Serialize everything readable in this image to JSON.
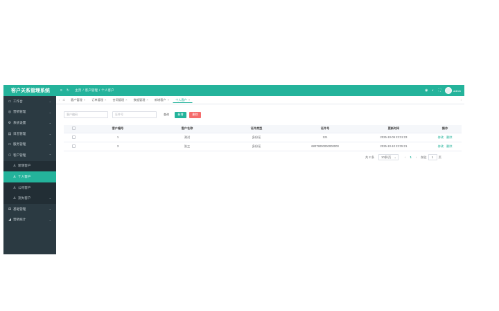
{
  "app": {
    "title": "客户关系管理系统"
  },
  "sidebar": {
    "items": [
      {
        "label": "工作台",
        "icon": "monitor-icon",
        "glyph": "▭",
        "arrow": "⌄"
      },
      {
        "label": "营销管理",
        "icon": "target-icon",
        "glyph": "◎",
        "arrow": "⌄"
      },
      {
        "label": "系统设置",
        "icon": "gear-icon",
        "glyph": "⚙",
        "arrow": "⌄"
      },
      {
        "label": "日志管理",
        "icon": "log-icon",
        "glyph": "▤",
        "arrow": "⌄"
      },
      {
        "label": "服务管理",
        "icon": "service-icon",
        "glyph": "▭",
        "arrow": "⌄"
      },
      {
        "label": "客户管理",
        "icon": "users-icon",
        "glyph": "⚇",
        "arrow": "⌃"
      },
      {
        "label": "新增客户",
        "icon": "user-icon",
        "glyph": "♙",
        "sub": true
      },
      {
        "label": "个人客户",
        "icon": "user-icon",
        "glyph": "♙",
        "sub": true,
        "active": true
      },
      {
        "label": "公司客户",
        "icon": "user-icon",
        "glyph": "♙",
        "sub": true
      },
      {
        "label": "流失客户",
        "icon": "user-icon",
        "glyph": "♙",
        "sub": true,
        "arrow": "⌄"
      },
      {
        "label": "基础管理",
        "icon": "grid-icon",
        "glyph": "⊞",
        "arrow": "⌄"
      },
      {
        "label": "营销统计",
        "icon": "chart-icon",
        "glyph": "◢",
        "arrow": "⌄"
      }
    ]
  },
  "topbar": {
    "breadcrumb": [
      "主页",
      "客户管理",
      "个人客户"
    ],
    "sep": "/",
    "menu_glyph": "≡",
    "refresh_glyph": "↻",
    "right_glyphs": [
      "◉",
      "◐",
      "⛶"
    ],
    "username": "admin"
  },
  "tabs": {
    "left_arrow": "‹",
    "right_arrow": "›",
    "home_glyph": "⌂",
    "close": "×",
    "items": [
      {
        "label": "客户管理"
      },
      {
        "label": "订单管理"
      },
      {
        "label": "合同管理"
      },
      {
        "label": "数据管理"
      },
      {
        "label": "新增客户"
      },
      {
        "label": "个人客户",
        "active": true
      }
    ]
  },
  "filters": {
    "customer_no_placeholder": "客户编码",
    "name_placeholder": "证件号",
    "search_label": "查询",
    "add_label": "新增",
    "delete_label": "删除"
  },
  "table": {
    "columns": [
      "客户编号",
      "客户名称",
      "证件类型",
      "证件号",
      "更新时间",
      "操作"
    ],
    "rows": [
      {
        "no": "1",
        "name": "测试",
        "id_type": "身份证",
        "id_no": "121",
        "updated": "2025-10-09 23:31:23",
        "edit": "修改",
        "del": "删除"
      },
      {
        "no": "3",
        "name": "张三",
        "id_type": "身份证",
        "id_no": "68079000000000000",
        "updated": "2025-10-10 23:35:21",
        "edit": "修改",
        "del": "删除"
      }
    ]
  },
  "pager": {
    "total": "共 2 条",
    "page_size": "10条/页",
    "prev": "‹",
    "current": "1",
    "next": "›",
    "goto_label": "前往",
    "goto_value": "1",
    "page_unit": "页"
  },
  "colors": {
    "accent": "#24b39b",
    "sidebar_bg": "#2b3a42",
    "danger": "#f56c6c"
  }
}
